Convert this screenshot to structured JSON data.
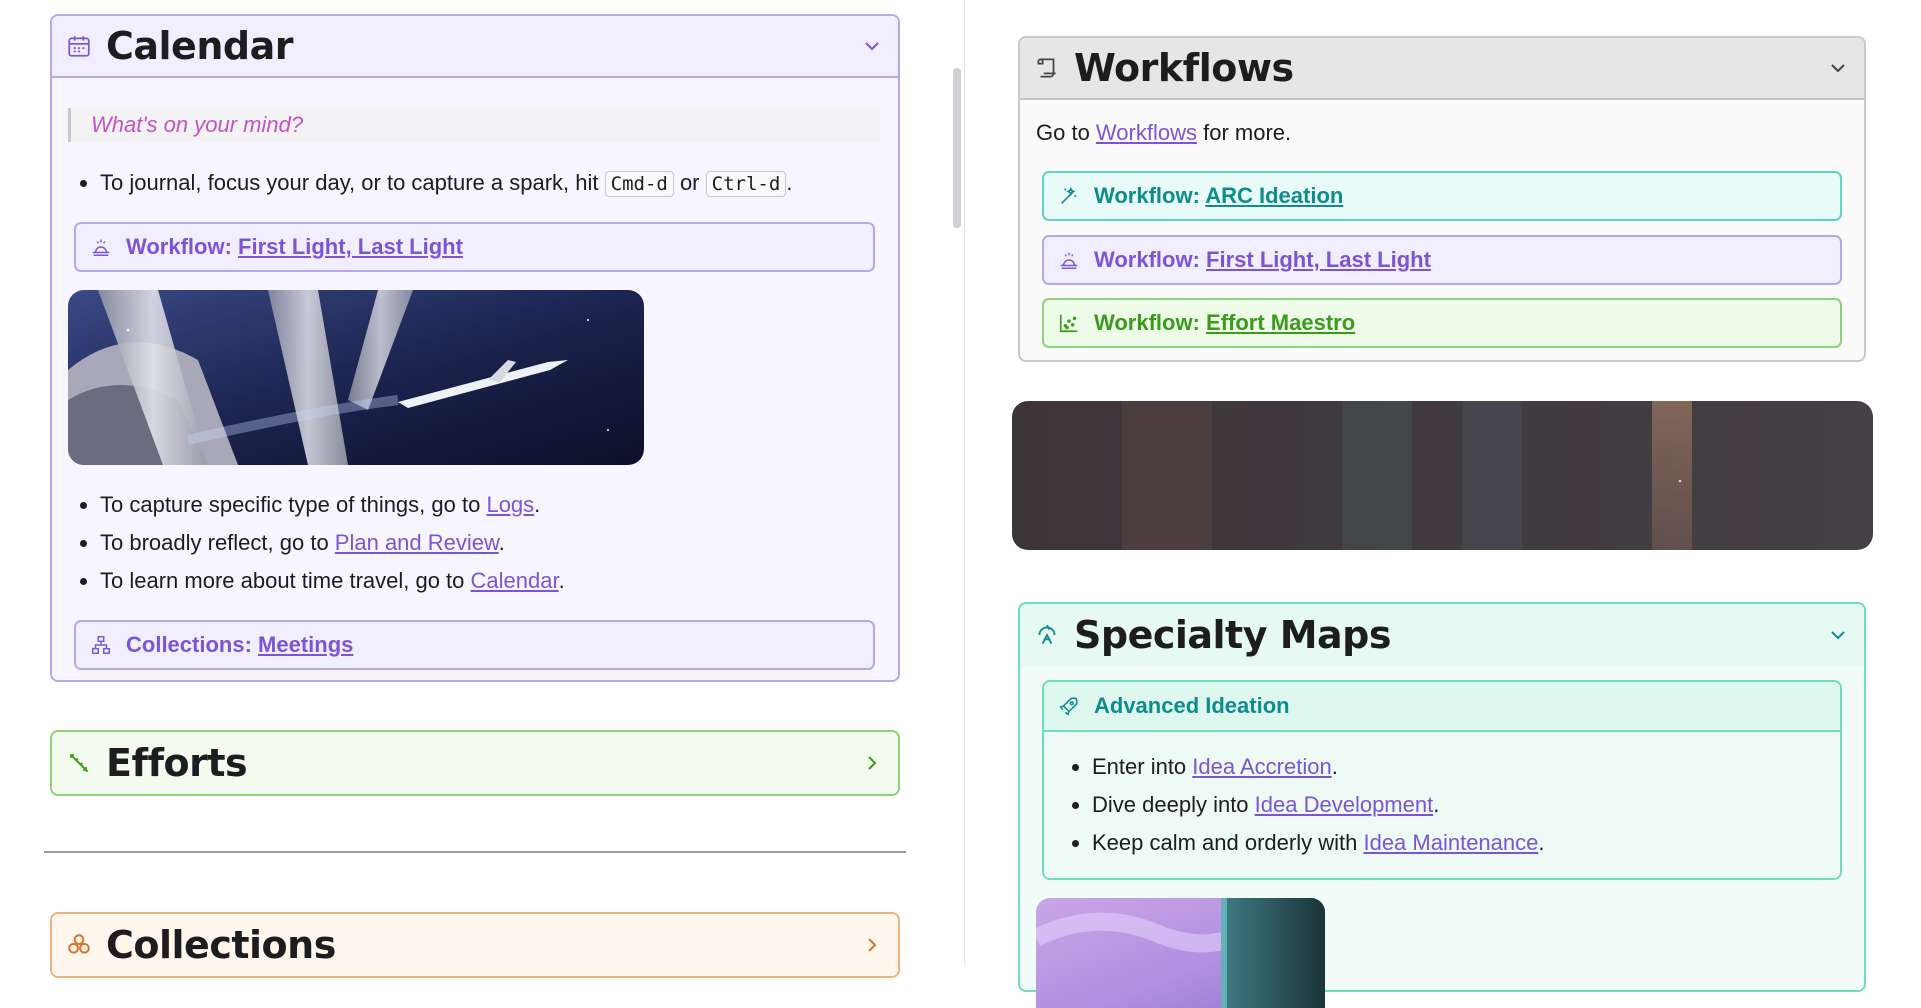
{
  "left": {
    "calendar": {
      "title": "Calendar",
      "prompt": "What's on your mind?",
      "bullet1_pre": "To journal, focus your day, or to capture a spark, hit ",
      "key1": "Cmd-d",
      "bullet1_or": " or ",
      "key2": "Ctrl-d",
      "bullet1_end": ".",
      "workflow_prefix": "Workflow: ",
      "workflow_link": "First Light, Last Light",
      "bullets": [
        {
          "pre": "To capture specific type of things, go to ",
          "link": "Logs",
          "post": "."
        },
        {
          "pre": "To broadly reflect, go to ",
          "link": "Plan and Review",
          "post": "."
        },
        {
          "pre": "To learn more about time travel, go to ",
          "link": "Calendar",
          "post": "."
        }
      ],
      "collections_prefix": "Collections: ",
      "collections_link": "Meetings"
    },
    "efforts": {
      "title": "Efforts"
    },
    "collections": {
      "title": "Collections"
    }
  },
  "right": {
    "workflows": {
      "title": "Workflows",
      "intro_pre": "Go to ",
      "intro_link": "Workflows",
      "intro_post": " for more.",
      "items": [
        {
          "prefix": "Workflow: ",
          "link": "ARC Ideation"
        },
        {
          "prefix": "Workflow: ",
          "link": "First Light, Last Light"
        },
        {
          "prefix": "Workflow: ",
          "link": "Effort Maestro"
        }
      ]
    },
    "specialty_maps": {
      "title": "Specialty Maps",
      "sub_title": "Advanced Ideation",
      "bullets": [
        {
          "pre": "Enter into ",
          "link": "Idea Accretion",
          "post": "."
        },
        {
          "pre": "Dive deeply into ",
          "link": "Idea Development",
          "post": "."
        },
        {
          "pre": "Keep calm and orderly with ",
          "link": "Idea Maintenance",
          "post": "."
        }
      ]
    }
  },
  "colors": {
    "link": "#7b55d6",
    "calendar_border": "#b7a8ee",
    "efforts_border": "#8fd27a",
    "collections_border": "#f1b27c",
    "teal": "#0f8c8c",
    "green": "#3c9a1f"
  },
  "icons": {
    "calendar": "calendar-icon",
    "workflow_sunrise": "sunrise-icon",
    "collections": "sitemap-icon",
    "efforts": "ruler-icon",
    "collections_header": "layers-icon",
    "workflows": "scroll-icon",
    "arc": "wand-icon",
    "effort_maestro": "chart-scatter-icon",
    "specialty": "compass-icon",
    "advanced": "rocket-icon"
  }
}
